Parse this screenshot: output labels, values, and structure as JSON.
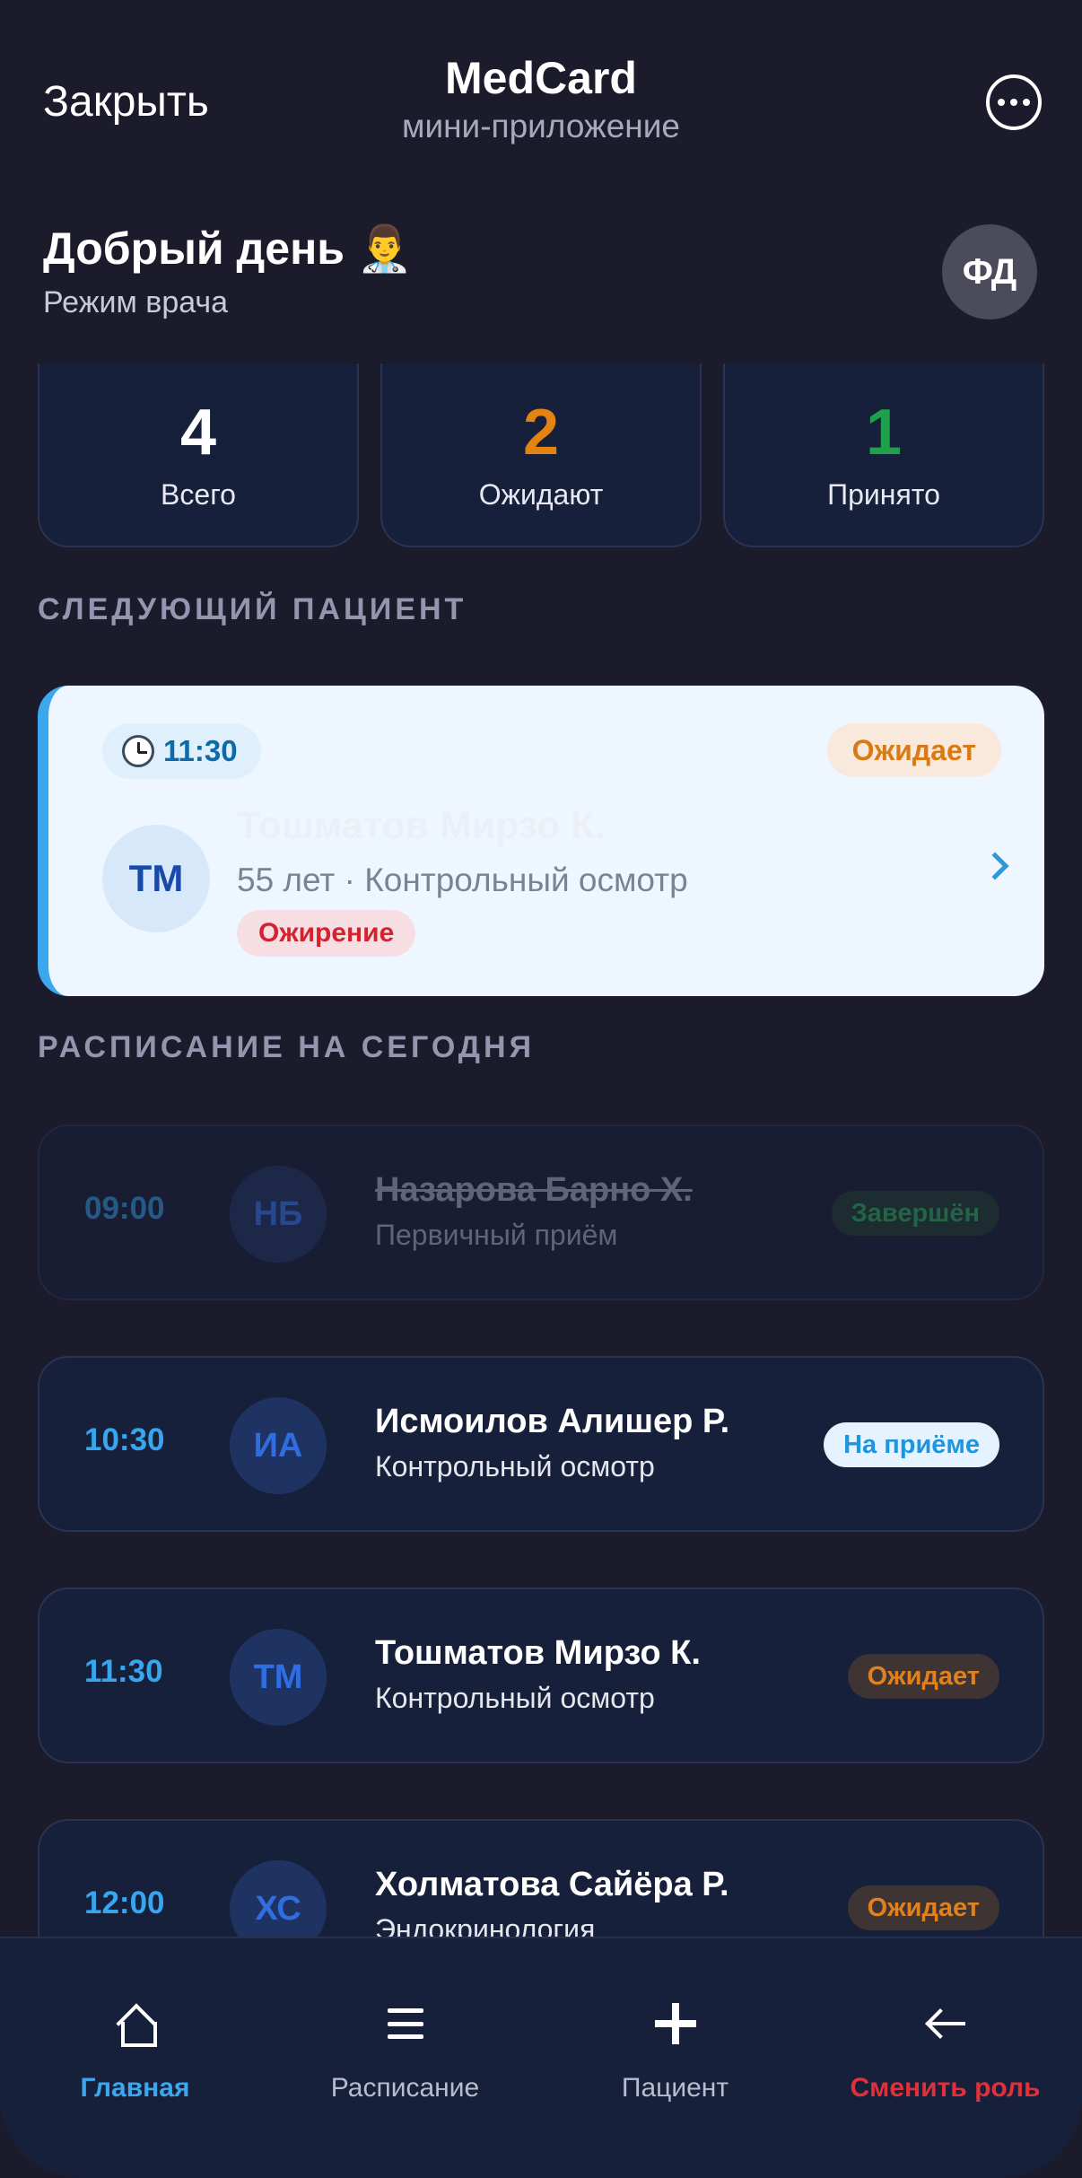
{
  "header": {
    "close_label": "Закрыть",
    "title": "MedCard",
    "subtitle": "мини-приложение"
  },
  "greeting": {
    "text": "Добрый день 👨‍⚕️",
    "mode": "Режим врача",
    "avatar_initials": "ФД"
  },
  "stats": [
    {
      "value": "4",
      "label": "Всего",
      "color": "#ffffff"
    },
    {
      "value": "2",
      "label": "Ожидают",
      "color": "#e38312"
    },
    {
      "value": "1",
      "label": "Принято",
      "color": "#1fa14b"
    }
  ],
  "next_patient": {
    "section_title": "СЛЕДУЮЩИЙ ПАЦИЕНТ",
    "time": "11:30",
    "status": "Ожидает",
    "initials": "ТМ",
    "name": "Тошматов Мирзо К.",
    "info": "55 лет · Контрольный осмотр",
    "diagnosis": "Ожирение"
  },
  "schedule": {
    "section_title": "РАСПИСАНИЕ НА СЕГОДНЯ",
    "items": [
      {
        "time": "09:00",
        "initials": "НБ",
        "name": "Назарова Барно Х.",
        "type": "Первичный приём",
        "status": "Завершён"
      },
      {
        "time": "10:30",
        "initials": "ИА",
        "name": "Исмоилов Алишер Р.",
        "type": "Контрольный осмотр",
        "status": "На приёме"
      },
      {
        "time": "11:30",
        "initials": "ТМ",
        "name": "Тошматов Мирзо К.",
        "type": "Контрольный осмотр",
        "status": "Ожидает"
      },
      {
        "time": "12:00",
        "initials": "ХС",
        "name": "Холматова Сайёра Р.",
        "type": "Эндокринология",
        "status": "Ожидает"
      }
    ]
  },
  "tabbar": [
    {
      "label": "Главная",
      "icon": "home-icon",
      "color": "#3aa7ee"
    },
    {
      "label": "Расписание",
      "icon": "list-icon",
      "color": "#b8bccc"
    },
    {
      "label": "Пациент",
      "icon": "plus-icon",
      "color": "#b8bccc"
    },
    {
      "label": "Сменить роль",
      "icon": "back-arrow-icon",
      "color": "#e0303a"
    }
  ]
}
